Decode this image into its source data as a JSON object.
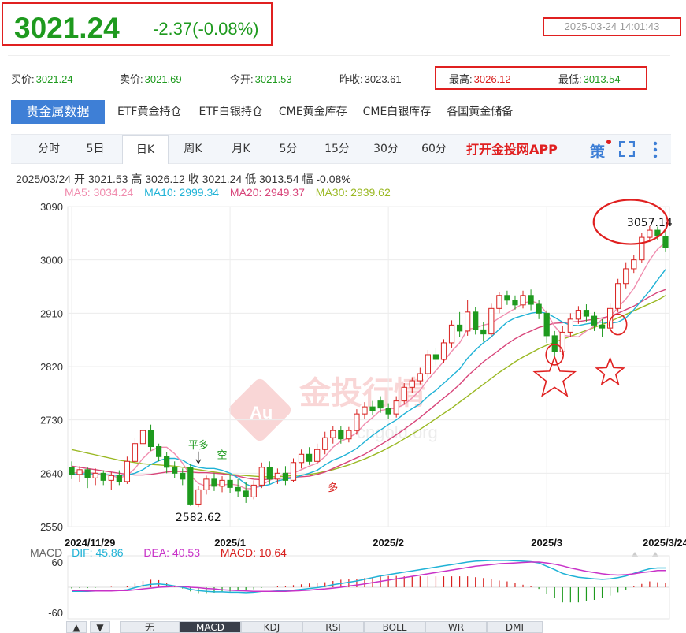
{
  "header": {
    "price": "3021.24",
    "change": "-2.37(-0.08%)",
    "datetime": "2025-03-24 14:01:43"
  },
  "quote": {
    "bid_label": "买价:",
    "bid": "3021.24",
    "ask_label": "卖价:",
    "ask": "3021.69",
    "open_label": "今开:",
    "open": "3021.53",
    "prev_close_label": "昨收:",
    "prev_close": "3023.61",
    "high_label": "最高:",
    "high": "3026.12",
    "low_label": "最低:",
    "low": "3013.54"
  },
  "top_tabs": [
    "贵金属数据",
    "ETF黄金持仓",
    "ETF白银持仓",
    "CME黄金库存",
    "CME白银库存",
    "各国黄金储备"
  ],
  "period_tabs": [
    "分时",
    "5日",
    "日K",
    "周K",
    "月K",
    "5分",
    "15分",
    "30分",
    "60分"
  ],
  "active_period": "日K",
  "app_link": "打开金投网APP",
  "strategy_icon": "策",
  "info_line": "2025/03/24  开 3021.53  高 3026.12  收 3021.24  低 3013.54  幅 -0.08%",
  "ma": {
    "ma5": "MA5: 3034.24",
    "ma10": "MA10: 2999.34",
    "ma20": "MA20: 2949.37",
    "ma30": "MA30: 2939.62"
  },
  "colors": {
    "up": "#d8201e",
    "down": "#1e9a1e",
    "ma5": "#f08cae",
    "ma10": "#1fb2d6",
    "ma20": "#d8457a",
    "ma30": "#9ab822",
    "dif": "#1fb2d6",
    "dea": "#c832c8",
    "annotation": "#e02020"
  },
  "watermark": {
    "logo": "Au",
    "cn": "金投行情",
    "en": "cngold.org"
  },
  "chart_data": {
    "type": "candlestick",
    "y_ticks": [
      "3090",
      "3000",
      "2910",
      "2820",
      "2730",
      "2640",
      "2550"
    ],
    "ylim": [
      2550,
      3090
    ],
    "x_ticks": [
      {
        "label": "2024/11/29",
        "index": 0
      },
      {
        "label": "2025/1",
        "index": 20
      },
      {
        "label": "2025/2",
        "index": 40
      },
      {
        "label": "2025/3",
        "index": 60
      },
      {
        "label": "2025/3/24",
        "index": 75
      }
    ],
    "candles": [
      [
        2650,
        2638,
        2660,
        2630
      ],
      [
        2638,
        2646,
        2652,
        2625
      ],
      [
        2646,
        2632,
        2650,
        2615
      ],
      [
        2632,
        2640,
        2648,
        2620
      ],
      [
        2640,
        2628,
        2645,
        2620
      ],
      [
        2628,
        2636,
        2642,
        2612
      ],
      [
        2636,
        2626,
        2645,
        2620
      ],
      [
        2626,
        2660,
        2668,
        2622
      ],
      [
        2660,
        2690,
        2700,
        2655
      ],
      [
        2690,
        2712,
        2718,
        2680
      ],
      [
        2712,
        2685,
        2722,
        2678
      ],
      [
        2685,
        2668,
        2690,
        2660
      ],
      [
        2668,
        2650,
        2676,
        2640
      ],
      [
        2650,
        2640,
        2660,
        2632
      ],
      [
        2640,
        2630,
        2648,
        2620
      ],
      [
        2650,
        2588,
        2655,
        2585
      ],
      [
        2588,
        2612,
        2618,
        2583
      ],
      [
        2612,
        2630,
        2636,
        2604
      ],
      [
        2630,
        2618,
        2640,
        2610
      ],
      [
        2618,
        2628,
        2635,
        2608
      ],
      [
        2628,
        2616,
        2638,
        2606
      ],
      [
        2616,
        2610,
        2630,
        2600
      ],
      [
        2610,
        2600,
        2625,
        2590
      ],
      [
        2600,
        2620,
        2628,
        2596
      ],
      [
        2620,
        2650,
        2658,
        2615
      ],
      [
        2650,
        2630,
        2660,
        2622
      ],
      [
        2630,
        2640,
        2648,
        2622
      ],
      [
        2640,
        2628,
        2652,
        2620
      ],
      [
        2628,
        2658,
        2665,
        2625
      ],
      [
        2658,
        2672,
        2680,
        2648
      ],
      [
        2672,
        2660,
        2684,
        2654
      ],
      [
        2660,
        2680,
        2690,
        2655
      ],
      [
        2680,
        2700,
        2710,
        2672
      ],
      [
        2700,
        2712,
        2720,
        2690
      ],
      [
        2712,
        2698,
        2720,
        2690
      ],
      [
        2698,
        2712,
        2718,
        2692
      ],
      [
        2712,
        2740,
        2748,
        2705
      ],
      [
        2740,
        2752,
        2760,
        2732
      ],
      [
        2752,
        2746,
        2762,
        2738
      ],
      [
        2762,
        2750,
        2770,
        2742
      ],
      [
        2750,
        2740,
        2758,
        2732
      ],
      [
        2740,
        2762,
        2770,
        2734
      ],
      [
        2762,
        2785,
        2792,
        2756
      ],
      [
        2785,
        2796,
        2802,
        2776
      ],
      [
        2796,
        2808,
        2818,
        2790
      ],
      [
        2808,
        2840,
        2848,
        2802
      ],
      [
        2840,
        2832,
        2852,
        2822
      ],
      [
        2832,
        2860,
        2866,
        2826
      ],
      [
        2860,
        2890,
        2898,
        2852
      ],
      [
        2890,
        2880,
        2912,
        2870
      ],
      [
        2880,
        2912,
        2932,
        2872
      ],
      [
        2912,
        2882,
        2920,
        2874
      ],
      [
        2882,
        2875,
        2895,
        2862
      ],
      [
        2875,
        2918,
        2926,
        2870
      ],
      [
        2918,
        2940,
        2946,
        2910
      ],
      [
        2940,
        2932,
        2948,
        2924
      ],
      [
        2932,
        2924,
        2940,
        2916
      ],
      [
        2924,
        2940,
        2948,
        2918
      ],
      [
        2940,
        2925,
        2950,
        2915
      ],
      [
        2925,
        2910,
        2932,
        2900
      ],
      [
        2910,
        2872,
        2915,
        2860
      ],
      [
        2872,
        2845,
        2880,
        2835
      ],
      [
        2845,
        2878,
        2888,
        2840
      ],
      [
        2878,
        2900,
        2910,
        2870
      ],
      [
        2900,
        2915,
        2922,
        2892
      ],
      [
        2915,
        2905,
        2925,
        2896
      ],
      [
        2905,
        2890,
        2912,
        2880
      ],
      [
        2890,
        2885,
        2900,
        2870
      ],
      [
        2885,
        2918,
        2926,
        2880
      ],
      [
        2918,
        2960,
        2968,
        2912
      ],
      [
        2960,
        2985,
        2996,
        2952
      ],
      [
        2985,
        3000,
        3008,
        2978
      ],
      [
        3000,
        3038,
        3046,
        2995
      ],
      [
        3038,
        3050,
        3057,
        3030
      ],
      [
        3050,
        3040,
        3056,
        3034
      ],
      [
        3040,
        3021,
        3048,
        3013
      ]
    ],
    "ma5": [
      2640,
      2642,
      2641,
      2640,
      2638,
      2636,
      2632,
      2636,
      2648,
      2665,
      2678,
      2684,
      2684,
      2673,
      2657,
      2636,
      2623,
      2618,
      2622,
      2620,
      2622,
      2620,
      2614,
      2614,
      2620,
      2628,
      2634,
      2640,
      2640,
      2646,
      2652,
      2657,
      2668,
      2684,
      2694,
      2700,
      2708,
      2723,
      2734,
      2746,
      2748,
      2750,
      2756,
      2767,
      2780,
      2798,
      2813,
      2829,
      2846,
      2860,
      2883,
      2885,
      2890,
      2893,
      2902,
      2910,
      2918,
      2926,
      2931,
      2926,
      2910,
      2888,
      2873,
      2871,
      2870,
      2880,
      2888,
      2900,
      2904,
      2920,
      2934,
      2952,
      2976,
      3000,
      3018,
      3030
    ],
    "ma10": [
      2638,
      2639,
      2639,
      2639,
      2638,
      2637,
      2636,
      2637,
      2640,
      2646,
      2655,
      2661,
      2665,
      2665,
      2662,
      2654,
      2650,
      2648,
      2648,
      2645,
      2640,
      2632,
      2622,
      2616,
      2618,
      2621,
      2627,
      2630,
      2632,
      2636,
      2640,
      2645,
      2654,
      2662,
      2667,
      2674,
      2682,
      2693,
      2704,
      2713,
      2722,
      2730,
      2740,
      2749,
      2757,
      2770,
      2780,
      2792,
      2804,
      2816,
      2834,
      2848,
      2860,
      2870,
      2883,
      2895,
      2902,
      2906,
      2910,
      2912,
      2910,
      2903,
      2895,
      2890,
      2889,
      2892,
      2894,
      2895,
      2893,
      2895,
      2902,
      2916,
      2932,
      2948,
      2966,
      2984
    ],
    "ma20": [
      2652,
      2650,
      2648,
      2646,
      2644,
      2642,
      2640,
      2638,
      2637,
      2637,
      2638,
      2640,
      2642,
      2643,
      2643,
      2642,
      2641,
      2641,
      2640,
      2639,
      2637,
      2635,
      2632,
      2630,
      2629,
      2630,
      2631,
      2632,
      2633,
      2634,
      2635,
      2638,
      2642,
      2648,
      2654,
      2660,
      2666,
      2672,
      2680,
      2688,
      2696,
      2705,
      2714,
      2724,
      2734,
      2745,
      2756,
      2767,
      2778,
      2790,
      2804,
      2816,
      2828,
      2838,
      2848,
      2858,
      2867,
      2874,
      2880,
      2886,
      2890,
      2893,
      2894,
      2895,
      2896,
      2898,
      2900,
      2902,
      2905,
      2910,
      2916,
      2922,
      2930,
      2938,
      2945,
      2950
    ],
    "ma30": [
      2680,
      2677,
      2674,
      2671,
      2668,
      2665,
      2662,
      2660,
      2658,
      2656,
      2655,
      2654,
      2653,
      2652,
      2650,
      2648,
      2646,
      2644,
      2642,
      2640,
      2638,
      2637,
      2636,
      2635,
      2634,
      2634,
      2634,
      2635,
      2636,
      2637,
      2638,
      2640,
      2643,
      2646,
      2650,
      2654,
      2659,
      2664,
      2670,
      2676,
      2683,
      2690,
      2698,
      2706,
      2714,
      2723,
      2732,
      2741,
      2750,
      2760,
      2770,
      2780,
      2790,
      2800,
      2810,
      2819,
      2828,
      2836,
      2843,
      2850,
      2856,
      2861,
      2866,
      2871,
      2876,
      2881,
      2886,
      2891,
      2896,
      2902,
      2908,
      2914,
      2920,
      2926,
      2932,
      2940
    ],
    "annotations": [
      {
        "type": "text",
        "text": "平多",
        "index": 16,
        "value": 2682,
        "arrow": true
      },
      {
        "type": "text",
        "text": "空",
        "index": 19,
        "value": 2665
      },
      {
        "type": "text",
        "text": "多",
        "index": 33,
        "value": 2610
      },
      {
        "type": "low_label",
        "text": "2582.62",
        "index": 16,
        "value": 2583
      },
      {
        "type": "high_label",
        "text": "3057.14",
        "index": 73,
        "value": 3057
      }
    ],
    "circles": [
      {
        "index": 61,
        "value": 2840
      },
      {
        "index": 69,
        "value": 2891
      }
    ],
    "stars": [
      {
        "index": 61,
        "value": 2800
      },
      {
        "index": 68,
        "value": 2810
      }
    ],
    "high_ellipse": {
      "index": 70,
      "value": 3064
    },
    "macd": {
      "dif_label": "DIF: 45.86",
      "dea_label": "DEA: 40.53",
      "macd_label": "MACD: 10.64",
      "y_ticks": [
        "60",
        "-60"
      ],
      "ylim": [
        -75,
        75
      ],
      "dif": [
        -10,
        -10,
        -10,
        -9,
        -9,
        -8,
        -8,
        -6,
        -1,
        4,
        7,
        8,
        6,
        3,
        0,
        -5,
        -8,
        -10,
        -11,
        -11,
        -12,
        -12,
        -13,
        -12,
        -10,
        -10,
        -9,
        -9,
        -7,
        -5,
        -3,
        -1,
        2,
        6,
        9,
        12,
        15,
        19,
        23,
        27,
        30,
        33,
        36,
        39,
        42,
        45,
        48,
        51,
        54,
        57,
        60,
        62,
        63,
        64,
        64,
        64,
        63,
        62,
        61,
        58,
        50,
        42,
        33,
        28,
        24,
        22,
        20,
        19,
        20,
        23,
        27,
        33,
        39,
        44,
        46,
        46
      ],
      "dea": [
        -8,
        -8,
        -9,
        -9,
        -9,
        -9,
        -8,
        -8,
        -6,
        -4,
        -2,
        0,
        1,
        2,
        2,
        0,
        -1,
        -3,
        -4,
        -6,
        -7,
        -8,
        -9,
        -10,
        -10,
        -10,
        -10,
        -10,
        -9,
        -8,
        -7,
        -5,
        -4,
        -2,
        0,
        3,
        5,
        8,
        11,
        14,
        17,
        20,
        23,
        26,
        29,
        32,
        35,
        38,
        41,
        44,
        47,
        50,
        52,
        54,
        56,
        57,
        58,
        59,
        60,
        60,
        58,
        55,
        51,
        46,
        42,
        38,
        35,
        32,
        30,
        29,
        30,
        32,
        35,
        37,
        40,
        40
      ],
      "hist": [
        -3,
        -2,
        -2,
        -1,
        0,
        1,
        0,
        3,
        9,
        15,
        18,
        17,
        11,
        3,
        -3,
        -10,
        -14,
        -14,
        -13,
        -10,
        -10,
        -9,
        -8,
        -5,
        -1,
        0,
        2,
        3,
        5,
        7,
        9,
        10,
        12,
        15,
        18,
        19,
        20,
        22,
        24,
        26,
        27,
        27,
        26,
        26,
        26,
        26,
        26,
        26,
        26,
        26,
        26,
        24,
        22,
        20,
        16,
        14,
        10,
        6,
        2,
        -4,
        -16,
        -26,
        -36,
        -36,
        -36,
        -32,
        -30,
        -26,
        -20,
        -12,
        -6,
        2,
        8,
        14,
        12,
        11
      ]
    }
  },
  "bottom_tabs": [
    "无",
    "MACD",
    "KDJ",
    "RSI",
    "BOLL",
    "WR",
    "DMI"
  ],
  "active_bottom_tab": "MACD"
}
